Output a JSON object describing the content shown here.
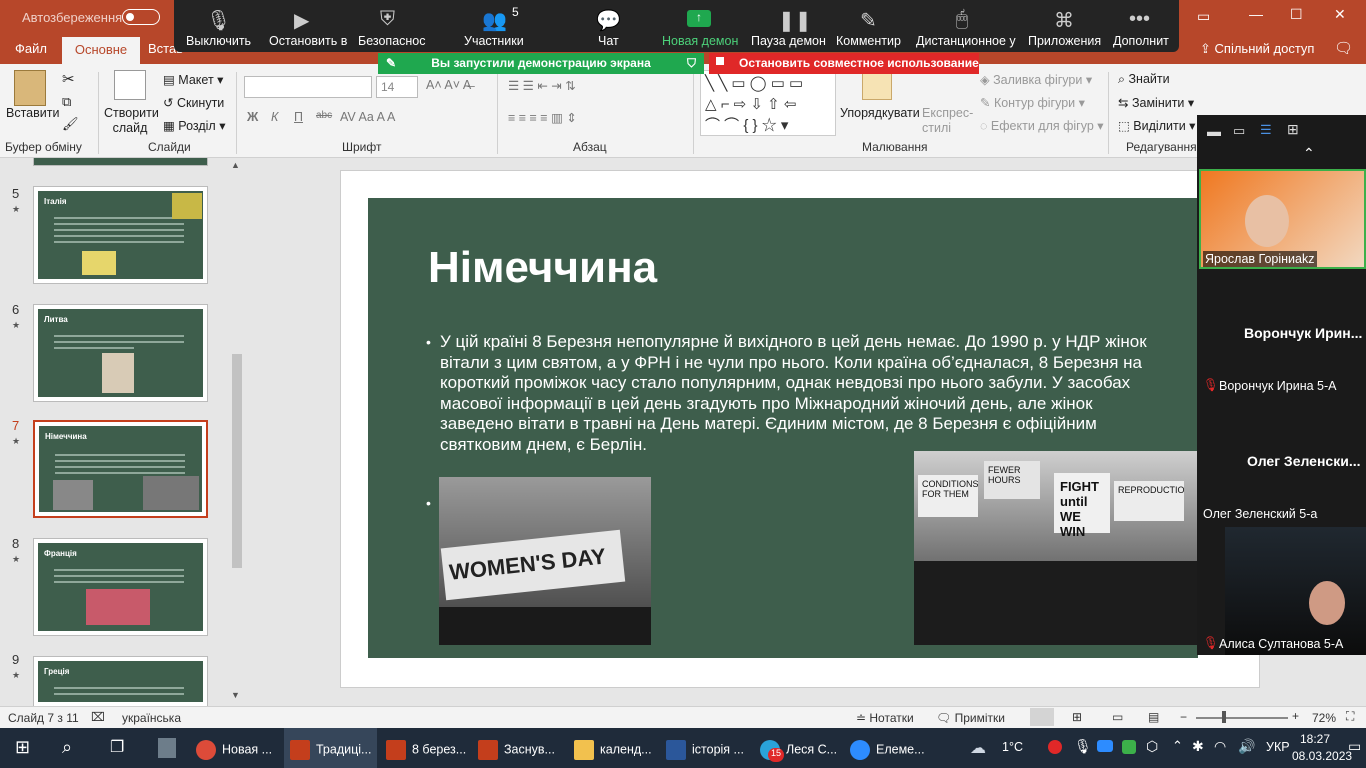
{
  "titlebar": {
    "autosave_label": "Автозбереження",
    "autosave_state": "Вимк",
    "restore_icon": "restore-icon",
    "minimize": "—",
    "maximize": "☐",
    "close": "✕"
  },
  "tabs": {
    "file": "Файл",
    "home": "Основне",
    "insert": "Встав",
    "share": "Спільний доступ"
  },
  "ribbon": {
    "paste": "Вставити",
    "clipboard_group": "Буфер обміну",
    "new_slide": "Створити слайд",
    "layout": "Макет",
    "reset": "Скинути",
    "section": "Розділ",
    "slides_group": "Слайди",
    "font_name": "",
    "font_size": "14",
    "bold": "Ж",
    "italic": "К",
    "underline": "П",
    "strike": "abc",
    "font_group": "Шрифт",
    "paragraph_group": "Абзац",
    "arrange": "Упорядкувати",
    "quick_styles": "Експрес-стилі",
    "shape_fill": "Заливка фігури",
    "shape_outline": "Контур фігури",
    "shape_effects": "Ефекти для фігур",
    "drawing_group": "Малювання",
    "find": "Знайти",
    "replace": "Замінити",
    "select": "Виділити",
    "editing_group": "Редагування"
  },
  "zoom": {
    "buttons": [
      {
        "label": "Выключить",
        "icon": "microphone-icon"
      },
      {
        "label": "Остановить в",
        "icon": "video-camera-icon"
      },
      {
        "label": "Безопаснос",
        "icon": "shield-icon"
      },
      {
        "label": "Участники",
        "icon": "participants-icon",
        "count": "5"
      },
      {
        "label": "Чат",
        "icon": "chat-icon"
      },
      {
        "label": "Новая демон",
        "icon": "share-screen-icon"
      },
      {
        "label": "Пауза демон",
        "icon": "pause-icon"
      },
      {
        "label": "Комментир",
        "icon": "annotate-icon"
      },
      {
        "label": "Дистанционное у",
        "icon": "remote-control-icon"
      },
      {
        "label": "Приложения",
        "icon": "apps-icon"
      },
      {
        "label": "Дополнит",
        "icon": "more-icon"
      }
    ],
    "share_banner": "Вы запустили демонстрацию экрана",
    "stop_banner": "Остановить совместное использование"
  },
  "thumbnails": [
    {
      "num": "5",
      "title": "Італія"
    },
    {
      "num": "6",
      "title": "Литва"
    },
    {
      "num": "7",
      "title": "Німеччина"
    },
    {
      "num": "8",
      "title": "Франція"
    },
    {
      "num": "9",
      "title": "Греція"
    }
  ],
  "slide": {
    "title": "Німеччина",
    "body": "У цій країні 8 Березня непопулярне й вихідного в цей день немає. До 1990 р. у НДР жінок вітали з цим святом, а у ФРН і не чули про нього. Коли країна об’єдналася, 8 Березня на короткий проміжок часу стало популярним, однак невдовзі про нього забули. У засобах масової інформації в цей день згадують про Міжнародний жіночий день, але жінок заведено вітати в травні на День матері. Єдиним містом, де 8 Березня є офіційним святковим днем, є Берлін.",
    "photo1_text": "WOMEN'S DAY",
    "photo2_signs": [
      "FIGHT until WE WIN",
      "CONDITIONS FOR THEM",
      "FEWER HOURS",
      "REPRODUCTIO"
    ]
  },
  "participants": [
    {
      "name": "Ярослав Горіниakz",
      "type": "video"
    },
    {
      "display": "Ворончук Ирин...",
      "name": "Ворончук Ирина 5-А",
      "muted": true
    },
    {
      "display": "Олег Зеленски...",
      "name": "Олег Зеленский 5-а",
      "muted": false
    },
    {
      "name": "Алиса Султанова 5-А",
      "type": "video",
      "muted": true
    }
  ],
  "statusbar": {
    "slide_info": "Слайд 7 з 11",
    "language": "українська",
    "notes": "Нотатки",
    "comments": "Примітки",
    "zoom": "72%"
  },
  "taskbar": {
    "items": [
      "Новая ...",
      "Традиці...",
      "8 берез...",
      "Заснув...",
      "календ...",
      "історія ...",
      "Леся С...",
      "Елеме..."
    ],
    "weather": "1°С",
    "lang": "УКР",
    "time": "18:27",
    "date": "08.03.2023",
    "badge": "15"
  },
  "colors": {
    "ppt_red": "#b7472a",
    "slide_green": "#3e5e4c",
    "zoom_dark": "#242424",
    "zoom_green": "#1fa84f",
    "zoom_red": "#e02828"
  }
}
